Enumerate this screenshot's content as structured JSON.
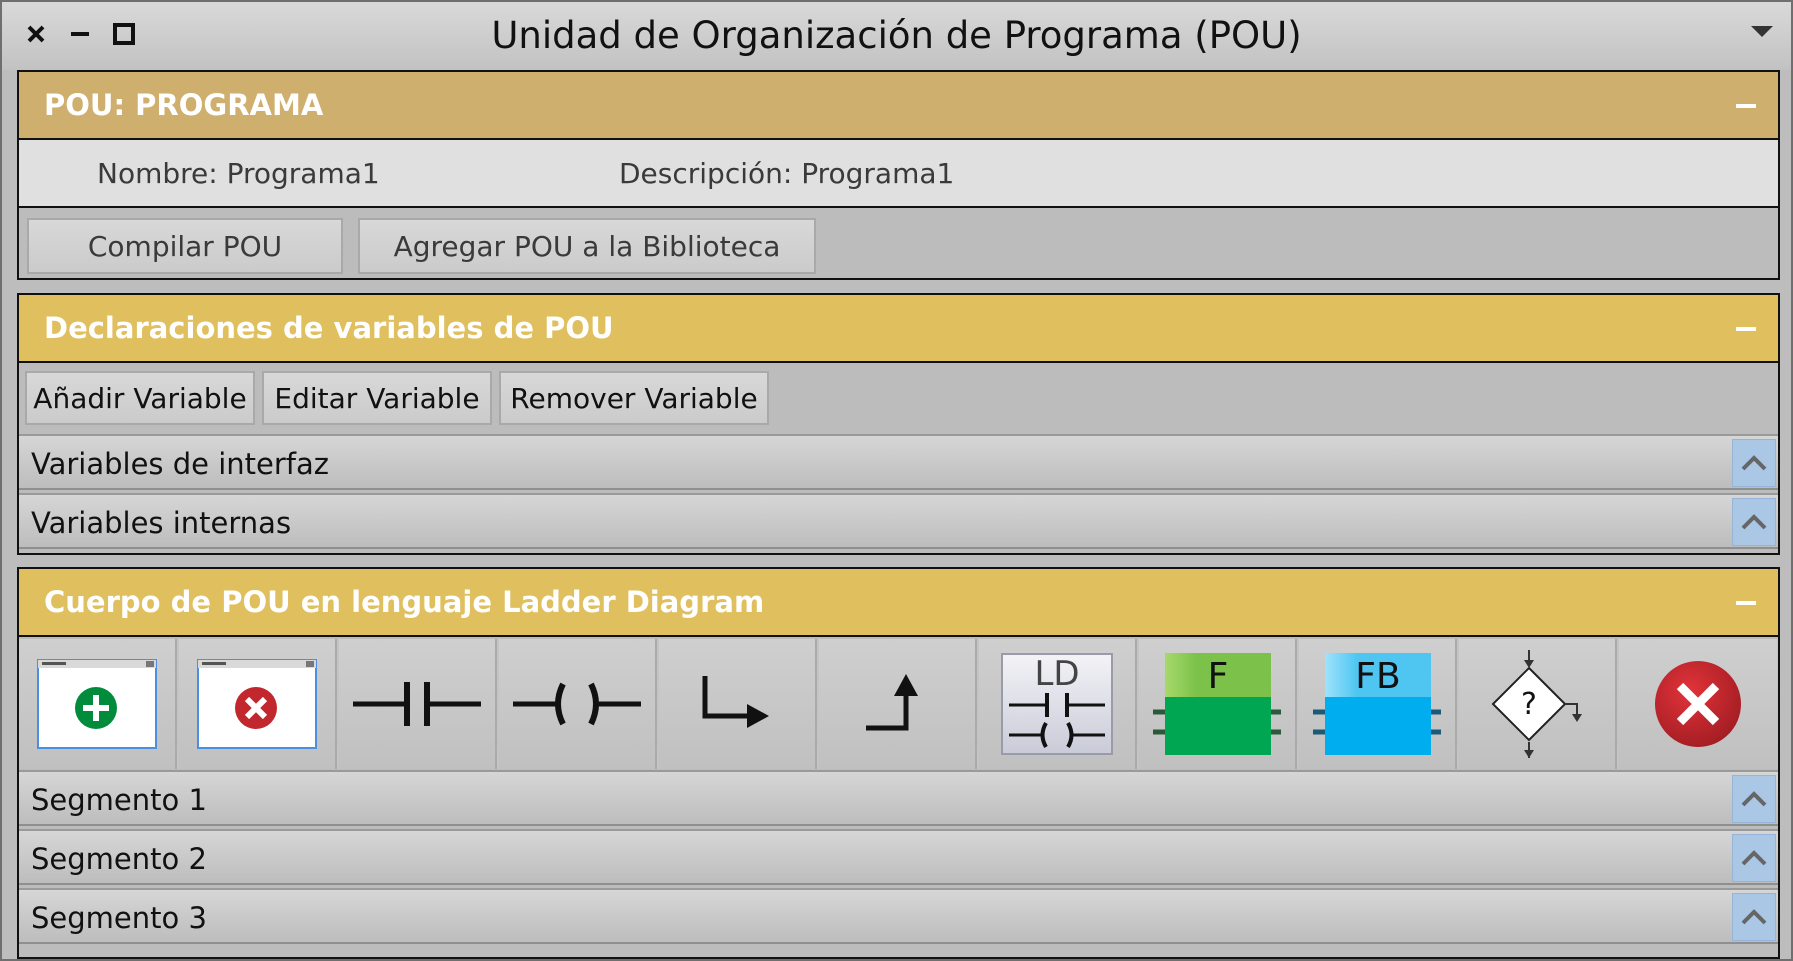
{
  "window": {
    "title": "Unidad de Organización de Programa (POU)",
    "controls": [
      "close-icon",
      "minimize-icon",
      "maximize-icon",
      "menu-dropdown-icon"
    ]
  },
  "pou_panel": {
    "title": "POU: PROGRAMA",
    "header_color": "#cfaf6e",
    "name_label": "Nombre: Programa1",
    "description_label": "Descripción: Programa1",
    "compile_button": "Compilar POU",
    "add_to_library_button": "Agregar POU a la Biblioteca"
  },
  "variables_panel": {
    "title": "Declaraciones de variables de POU",
    "header_color": "#e0bf5e",
    "add_button": "Añadir Variable",
    "edit_button": "Editar Variable",
    "remove_button": "Remover Variable",
    "sections": [
      {
        "label": "Variables de interfaz"
      },
      {
        "label": "Variables internas"
      }
    ]
  },
  "body_panel": {
    "title": "Cuerpo de POU en lenguaje Ladder Diagram",
    "header_color": "#e0bf5e",
    "tools": [
      {
        "icon": "add-segment-icon"
      },
      {
        "icon": "remove-segment-icon"
      },
      {
        "icon": "contact-icon"
      },
      {
        "icon": "coil-icon"
      },
      {
        "icon": "branch-icon"
      },
      {
        "icon": "branch-up-icon"
      },
      {
        "icon": "ladder-block-icon",
        "label": "LD"
      },
      {
        "icon": "function-block-icon",
        "label": "F"
      },
      {
        "icon": "function-block-instance-icon",
        "label": "FB"
      },
      {
        "icon": "condition-icon",
        "label": "?"
      },
      {
        "icon": "delete-icon"
      }
    ],
    "segments": [
      {
        "label": "Segmento 1"
      },
      {
        "label": "Segmento 2"
      },
      {
        "label": "Segmento 3"
      }
    ]
  },
  "colors": {
    "toggle_blue": "#aac7e6",
    "function_green": "#00a651",
    "function_block_blue": "#00aeef",
    "delete_red": "#c1272d",
    "add_green": "#008c3a"
  }
}
